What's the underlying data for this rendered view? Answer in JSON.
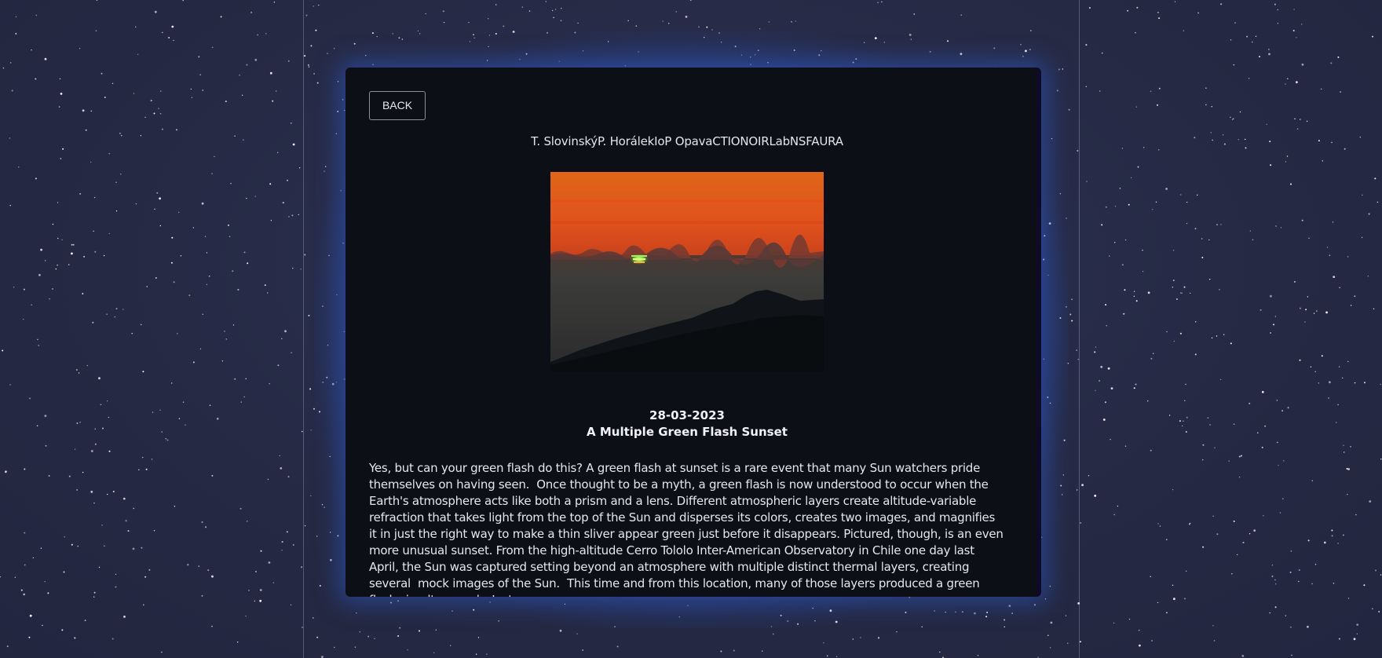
{
  "back_label": "BACK",
  "credits": "T. SlovinskýP. HorálekIoP OpavaCTIONOIRLabNSFAURA",
  "apod": {
    "date": "28-03-2023",
    "title": "A Multiple Green Flash Sunset",
    "explanation": "Yes, but can your green flash do this? A green flash at sunset is a rare event that many Sun watchers pride themselves on having seen.  Once thought to be a myth, a green flash is now understood to occur when the Earth's atmosphere acts like both a prism and a lens. Different atmospheric layers create altitude-variable refraction that takes light from the top of the Sun and disperses its colors, creates two images, and magnifies it in just the right way to make a thin sliver appear green just before it disappears. Pictured, though, is an even more unusual sunset. From the high-altitude Cerro Tololo Inter-American Observatory in Chile one day last April, the Sun was captured setting beyond an atmosphere with multiple distinct thermal layers, creating several  mock images of the Sun.  This time and from this location, many of those layers produced a green flash simultaneously. Just"
  },
  "colors": {
    "background": "#262a45",
    "card": "#0d0f17",
    "glow": "#2850be",
    "text": "#e6e6ec"
  }
}
